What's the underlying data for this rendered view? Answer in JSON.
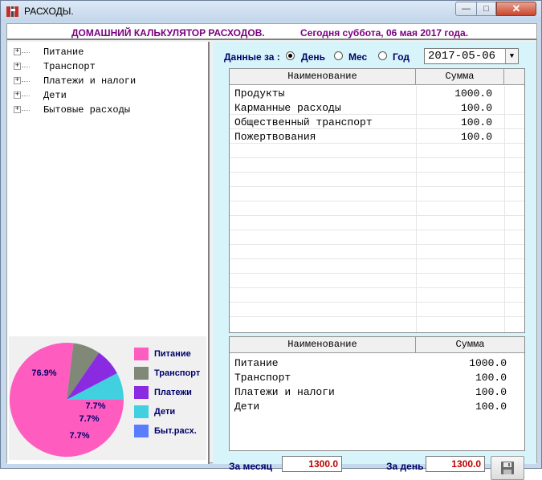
{
  "window": {
    "title": "РАСХОДЫ.",
    "minimize": "—",
    "maximize": "□",
    "close": "✕"
  },
  "banner": {
    "app_title": "ДОМАШНИЙ КАЛЬКУЛЯТОР РАСХОДОВ.",
    "today_text": "Сегодня суббота, 06 мая 2017 года."
  },
  "tree": {
    "items": [
      {
        "label": "Питание"
      },
      {
        "label": "Транспорт"
      },
      {
        "label": "Платежи и налоги"
      },
      {
        "label": "Дети"
      },
      {
        "label": "Бытовые расходы"
      }
    ]
  },
  "period": {
    "label": "Данные за :",
    "options": [
      "День",
      "Мес",
      "Год"
    ],
    "selected": "День",
    "date": "2017-05-06"
  },
  "top_grid": {
    "headers": [
      "Наименование",
      "Сумма"
    ],
    "rows": [
      {
        "name": "Продукты",
        "sum": "1000.0"
      },
      {
        "name": "Карманные расходы",
        "sum": "100.0"
      },
      {
        "name": "Общественный транспорт",
        "sum": "100.0"
      },
      {
        "name": "Пожертвования",
        "sum": "100.0"
      }
    ]
  },
  "bottom_grid": {
    "headers": [
      "Наименование",
      "Сумма"
    ],
    "rows": [
      {
        "name": "Питание",
        "sum": "1000.0"
      },
      {
        "name": "Транспорт",
        "sum": "100.0"
      },
      {
        "name": "Платежи и налоги",
        "sum": "100.0"
      },
      {
        "name": "Дети",
        "sum": "100.0"
      }
    ]
  },
  "totals": {
    "month_label": "За месяц",
    "month_value": "1300.0",
    "day_label": "За день",
    "day_value": "1300.0"
  },
  "save_icon": "floppy-disk-icon",
  "colors": {
    "pink": "#ff5cc0",
    "gray": "#808878",
    "purple": "#8a2be2",
    "cyan": "#40d0e0",
    "blue": "#5a7cff",
    "banner_text": "#7a0080"
  },
  "chart_data": {
    "type": "pie",
    "categories": [
      "Питание",
      "Транспорт",
      "Платежи",
      "Дети",
      "Быт.расх."
    ],
    "values": [
      76.9,
      7.7,
      7.7,
      7.7,
      0
    ],
    "labels": [
      "76.9%",
      "7.7%",
      "7.7%",
      "7.7%"
    ],
    "legend": "right"
  }
}
